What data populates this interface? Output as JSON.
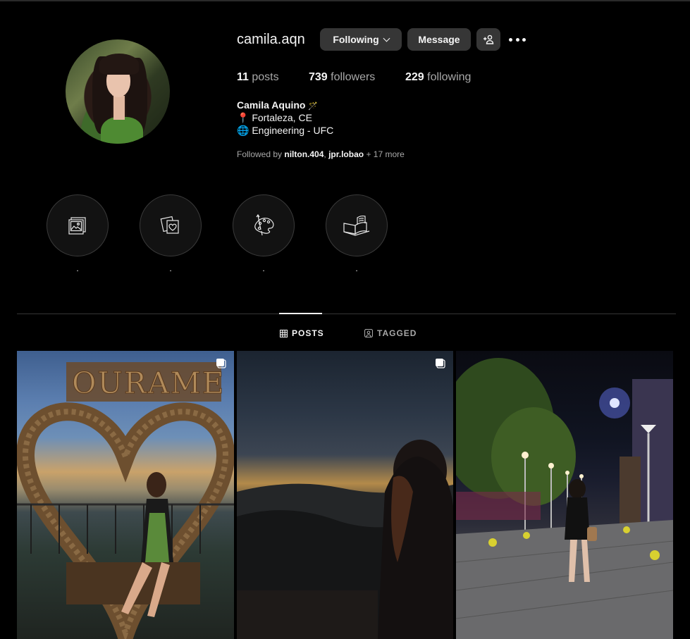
{
  "profile": {
    "username": "camila.aqn",
    "following_button": "Following",
    "message_button": "Message",
    "stats": {
      "posts_count": "11",
      "posts_label": "posts",
      "followers_count": "739",
      "followers_label": "followers",
      "following_count": "229",
      "following_label": "following"
    },
    "bio": {
      "name": "Camila Aquino",
      "name_emoji": "🪄",
      "location": "📍 Fortaleza, CE",
      "university": "🌐 Engineering - UFC"
    },
    "followed_by": {
      "prefix": "Followed by",
      "user1": "nilton.404",
      "separator": ",",
      "user2": "jpr.lobao",
      "more": "+ 17 more"
    }
  },
  "highlights": [
    {
      "label": ".",
      "icon": "photos-icon"
    },
    {
      "label": ".",
      "icon": "photo-heart-icon"
    },
    {
      "label": ".",
      "icon": "palette-icon"
    },
    {
      "label": ".",
      "icon": "open-book-icon"
    }
  ],
  "tabs": [
    {
      "label": "POSTS",
      "active": true
    },
    {
      "label": "TAGGED",
      "active": false
    }
  ],
  "posts": [
    {
      "multi": true,
      "description": "heart sculpture"
    },
    {
      "multi": true,
      "description": "sunset mountains"
    },
    {
      "multi": false,
      "description": "night street"
    }
  ],
  "colors": {
    "background": "#000000",
    "button": "#363636",
    "text_primary": "#f5f5f5",
    "text_secondary": "#a8a8a8"
  }
}
